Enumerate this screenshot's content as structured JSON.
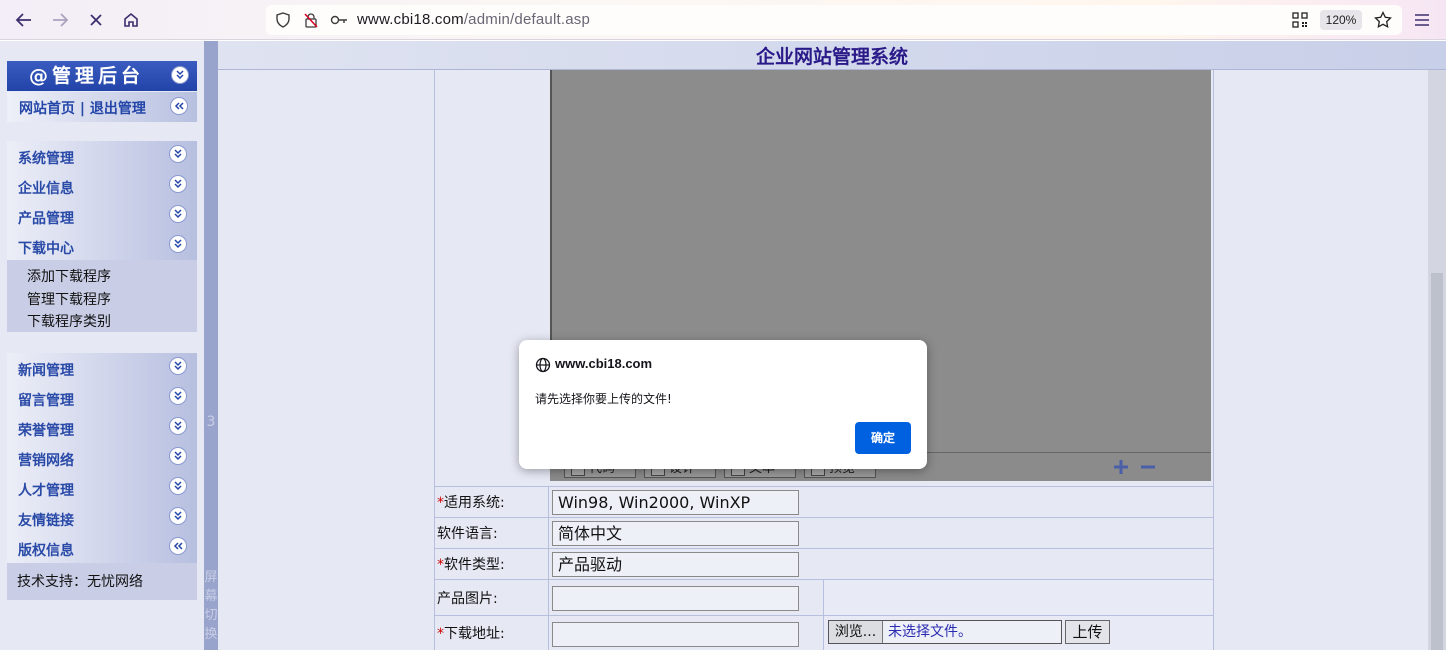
{
  "browser": {
    "url_domain": "www.cbi18.com",
    "url_path": "/admin/default.asp",
    "zoom": "120%"
  },
  "sidebar": {
    "header": "@管理后台",
    "top_links": "网站首页 | 退出管理",
    "menu": [
      {
        "label": "系统管理"
      },
      {
        "label": "企业信息"
      },
      {
        "label": "产品管理"
      },
      {
        "label": "下载中心"
      },
      {
        "label": "新闻管理"
      },
      {
        "label": "留言管理"
      },
      {
        "label": "荣誉管理"
      },
      {
        "label": "营销网络"
      },
      {
        "label": "人才管理"
      },
      {
        "label": "友情链接"
      },
      {
        "label": "版权信息"
      }
    ],
    "download_sub": [
      {
        "label": "添加下载程序"
      },
      {
        "label": "管理下载程序"
      },
      {
        "label": "下载程序类别"
      }
    ],
    "support": "技术支持：无忧网络"
  },
  "splitter": {
    "number": "3",
    "text": "屏幕切换"
  },
  "content": {
    "title": "企业网站管理系统",
    "editor_toolbar": [
      "代码",
      "设计",
      "文本",
      "预览"
    ],
    "form": {
      "os_label": "适用系统:",
      "os_value": "Win98, Win2000, WinXP",
      "lang_label": "软件语言:",
      "lang_value": "简体中文",
      "type_label": "软件类型:",
      "type_value": "产品驱动",
      "image_label": "产品图片:",
      "download_label": "下载地址:",
      "browse_label": "浏览...",
      "no_file": "未选择文件。",
      "upload_label": "上传",
      "required_mark": "*"
    }
  },
  "dialog": {
    "host": "www.cbi18.com",
    "message": "请先选择你要上传的文件!",
    "ok_label": "确定"
  },
  "colors": {
    "accent_blue": "#0061e0",
    "title_purple": "#2a1988",
    "menu_blue": "#2a4aa8"
  }
}
